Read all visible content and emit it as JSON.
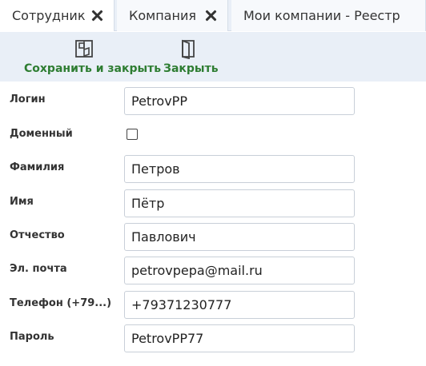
{
  "tabs": [
    {
      "label": "Сотрудник"
    },
    {
      "label": "Компания"
    },
    {
      "label": "Мои компании - Реестр"
    }
  ],
  "toolbar": {
    "save_close_label": "Сохранить и закрыть",
    "close_label": "Закрыть",
    "accent_color": "#2e7d32"
  },
  "form": {
    "login_label": "Логин",
    "login_value": "PetrovPP",
    "domain_label": "Доменный",
    "domain_checked": false,
    "surname_label": "Фамилия",
    "surname_value": "Петров",
    "name_label": "Имя",
    "name_value": "Пётр",
    "patronymic_label": "Отчество",
    "patronymic_value": "Павлович",
    "email_label": "Эл. почта",
    "email_value": "petrovpepa@mail.ru",
    "phone_label": "Телефон (+79...)",
    "phone_value": "+79371230777",
    "password_label": "Пароль",
    "password_value": "PetrovPP77"
  }
}
